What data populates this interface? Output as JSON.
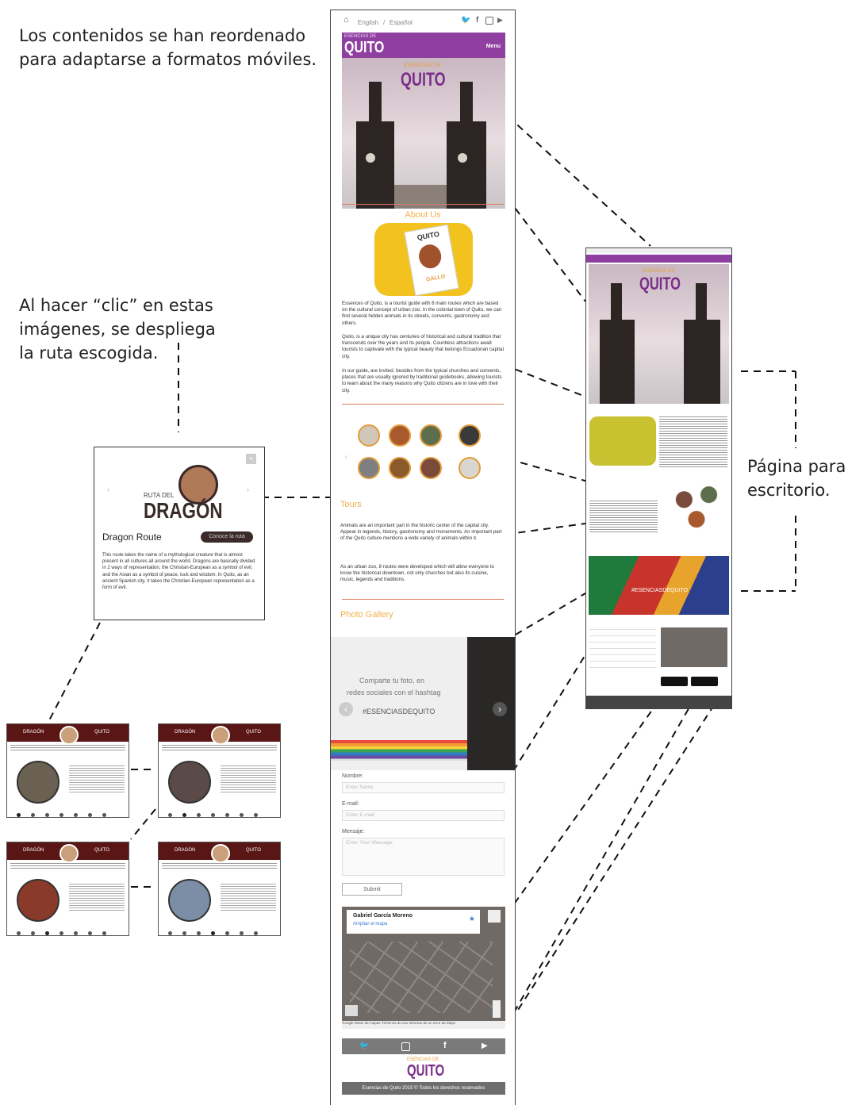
{
  "captions": {
    "top_left": [
      "Los contenidos se han reordenado",
      "para adaptarse a formatos móviles."
    ],
    "middle_left": [
      "Al hacer “clic” en estas",
      "imágenes, se despliega",
      "la ruta escogida."
    ],
    "right": [
      "Página para",
      "escritorio."
    ]
  },
  "mobile": {
    "nav": {
      "lang_en": "English",
      "lang_sep": "/",
      "lang_es": "Español"
    },
    "header": {
      "logo_small": "ESENCIAS DE",
      "logo": "QUITO",
      "menu": "Menu"
    },
    "hero": {
      "logo_small": "ESENCIAS DE",
      "logo": "QUITO"
    },
    "about": {
      "title": "About Us",
      "book_title": "QUITO",
      "book_label": "GALLO",
      "p1": "Essences of Quito, is a tourist guide with 8 main routes which are based on the cultural concept of urban zoo. In the colonial town of Quito, we can find several hidden animals in its streets, convents, gastronomy and others.",
      "p2": "Quito, is a unique city has centuries of historical and cultural tradition that transcends over the years and its people. Countless attractions await tourists to captivate with the typical beauty that belongs Ecuadorian capital city.",
      "p3": "In our guide, are invited, besides from the typical churches and convents, places that are usually ignored by traditional guidebooks, allowing tourists to learn about the many reasons why Quito citizens are in love with their city."
    },
    "tours": {
      "title": "Tours",
      "p1": "Animals are an important part in the historic center of the capital city. Appear in legends, history, gastronomy and monuments. An important part of the Quito culture mentions a wide variety of animals within it.",
      "p2": "As an urban zoo, 8 routes were developed which will allow everyone to know the historical downtown, not only churches but also its cuisine, music, legends and traditions."
    },
    "gallery": {
      "title": "Photo Gallery",
      "line1": "Comparte tu foto, en",
      "line2": "redes sociales con el hashtag",
      "hashtag": "#ESENCIASDEQUITO"
    },
    "form": {
      "name_label": "Nombre:",
      "name_placeholder": "Enter Name",
      "email_label": "E-mail:",
      "email_placeholder": "Enter E-mail",
      "message_label": "Mensaje:",
      "message_placeholder": "Enter Your Message",
      "submit": "Submit"
    },
    "map": {
      "place": "Gabriel García Moreno",
      "link": "Ampliar el mapa",
      "footer_text": "Google  Datos de mapas  Términos de uso  Informar de un error de Maps"
    },
    "footer": {
      "logo_small": "ESENCIAS DE",
      "logo": "QUITO",
      "copyright": "Esencias de Quito 2015 © Todos los derechos reservados"
    }
  },
  "popup": {
    "route_small": "RUTA DEL",
    "route_big": "DRAGÓN",
    "heading": "Dragon Route",
    "button": "Conoce la ruta",
    "body": "This route takes the name of a mythological creature that is almost present in all cultures all around the world. Dragons are basically divided in 2 ways of representation, the Christian-European as a symbol of evil, and the Asian as a symbol of peace, luck and wisdom. In Quito, as an ancient Spanish city, it takes the Christian-European representation as a form of evil."
  },
  "cards": {
    "left_label": "DRAGÓN",
    "right_label": "QUITO"
  },
  "desktop": {
    "logo": "QUITO",
    "logo_small": "ESENCIAS DE",
    "hashtag": "#ESENCIASDEQUITO"
  },
  "colors": {
    "purple": "#8e3fa0",
    "orange": "#f0b049",
    "maroon": "#5a1515"
  }
}
